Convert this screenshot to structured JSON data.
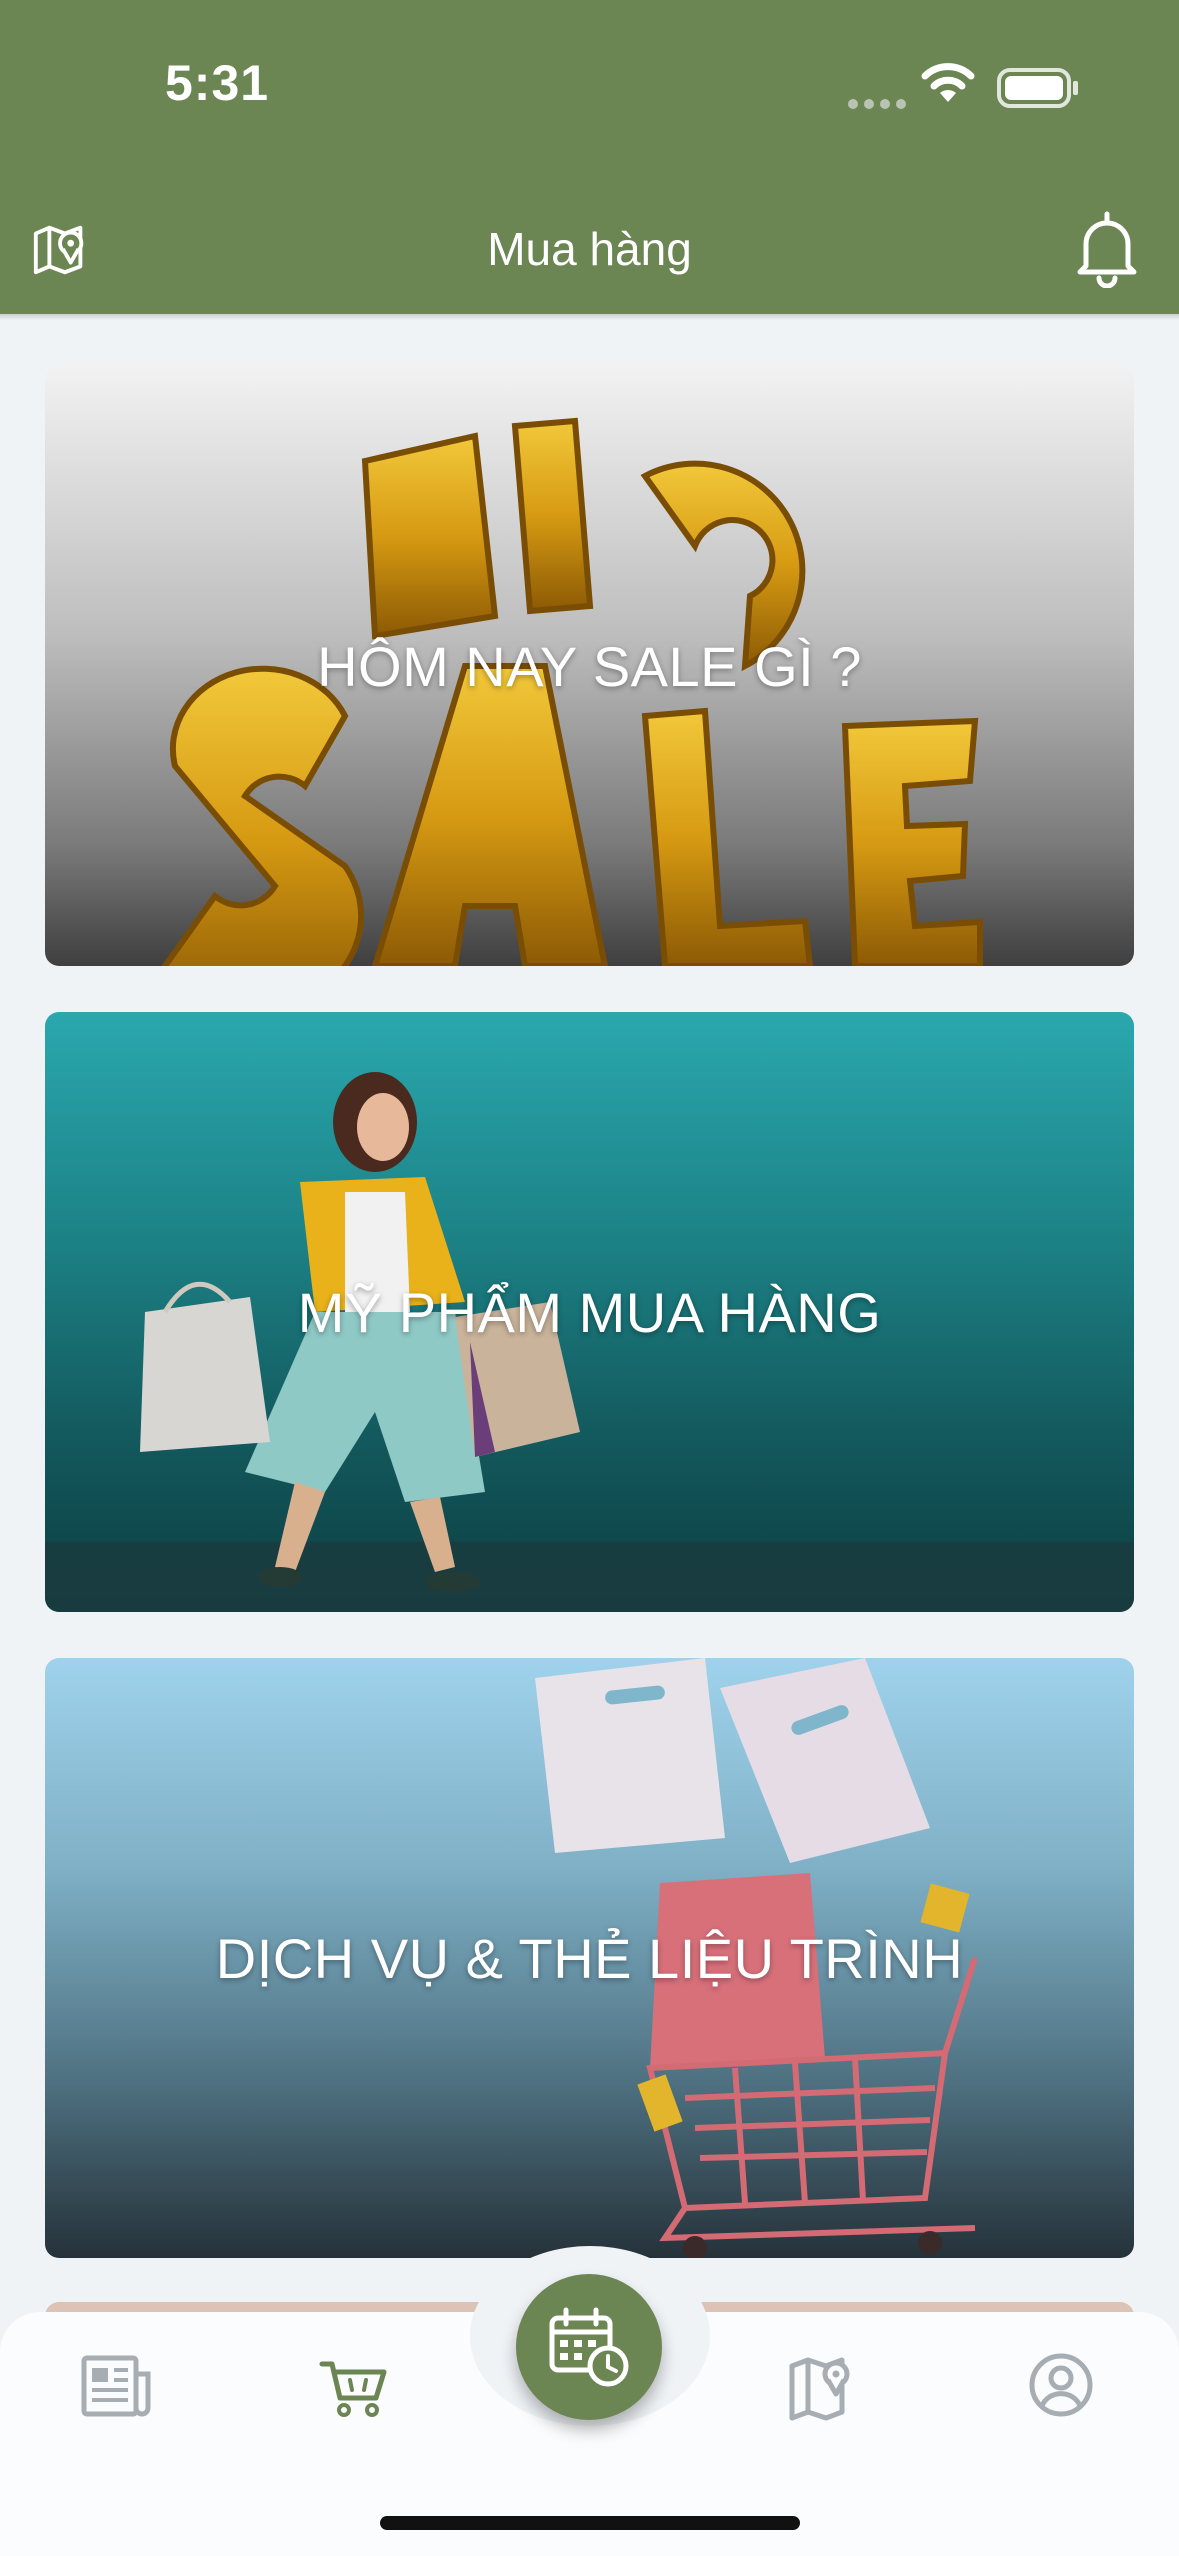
{
  "status_bar": {
    "time": "5:31"
  },
  "header": {
    "title": "Mua hàng",
    "left_icon": "map-pin-icon",
    "right_icon": "bell-icon",
    "background": "#6b8553"
  },
  "categories": [
    {
      "label": "HÔM NAY SALE GÌ ?",
      "image": "big-sale-gold-text"
    },
    {
      "label": "MỸ PHẨM MUA HÀNG",
      "image": "woman-with-shopping-bags"
    },
    {
      "label": "DỊCH VỤ & THẺ LIỆU TRÌNH",
      "image": "shopping-cart-with-bags"
    }
  ],
  "tabbar": {
    "items": [
      {
        "icon": "newspaper-icon",
        "active": false
      },
      {
        "icon": "cart-icon",
        "active": true
      },
      {
        "icon": "calendar-clock-icon",
        "center": true
      },
      {
        "icon": "map-icon",
        "active": false
      },
      {
        "icon": "user-circle-icon",
        "active": false
      }
    ],
    "active_color": "#6b8553",
    "inactive_color": "#a6adb3"
  }
}
